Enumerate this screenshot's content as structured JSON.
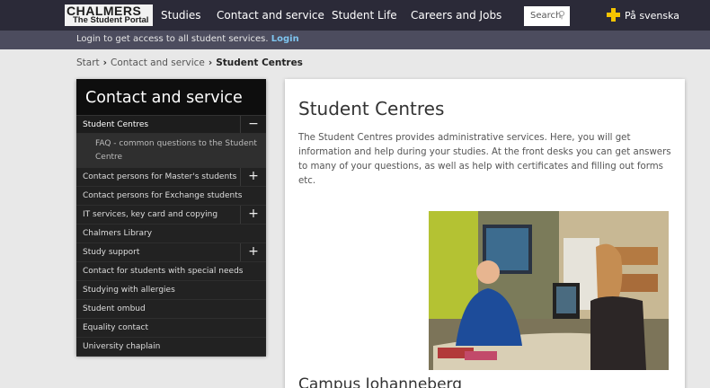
{
  "header": {
    "logo_line1": "CHALMERS",
    "logo_line2": "The Student Portal",
    "nav": [
      "Studies",
      "Contact and service",
      "Student Life",
      "Careers and Jobs"
    ],
    "search_placeholder": "Search",
    "language_label": "På svenska"
  },
  "login_bar": {
    "text": "Login to get access to all student services.",
    "link": "Login"
  },
  "breadcrumb": {
    "items": [
      "Start",
      "Contact and service"
    ],
    "current": "Student Centres"
  },
  "sidebar": {
    "title": "Contact and service",
    "active": {
      "label": "Student Centres",
      "toggle": "−"
    },
    "subitem": "FAQ - common questions to the Student Centre",
    "items": [
      {
        "label": "Contact persons for Master's students",
        "toggle": "+"
      },
      {
        "label": "Contact persons for Exchange students",
        "toggle": ""
      },
      {
        "label": "IT services, key card and copying",
        "toggle": "+"
      },
      {
        "label": "Chalmers Library",
        "toggle": ""
      },
      {
        "label": "Study support",
        "toggle": "+"
      },
      {
        "label": "Contact for students with special needs",
        "toggle": ""
      },
      {
        "label": "Studying with allergies",
        "toggle": ""
      },
      {
        "label": "Student ombud",
        "toggle": ""
      },
      {
        "label": "Equality contact",
        "toggle": ""
      },
      {
        "label": "University chaplain",
        "toggle": ""
      }
    ]
  },
  "content": {
    "title": "Student Centres",
    "intro": "The Student Centres provides administrative services. Here, you will get information and help during your studies. At the front desks you can get answers to many of your questions, as well as help with certificates and filling out forms etc.",
    "section_title": "Campus Johanneberg"
  },
  "colors": {
    "topbar": "#2b2a38",
    "loginbar": "#4c4c5e",
    "link": "#7ec4ee",
    "sidebar": "#222222",
    "flag_cross": "#f5c400"
  }
}
